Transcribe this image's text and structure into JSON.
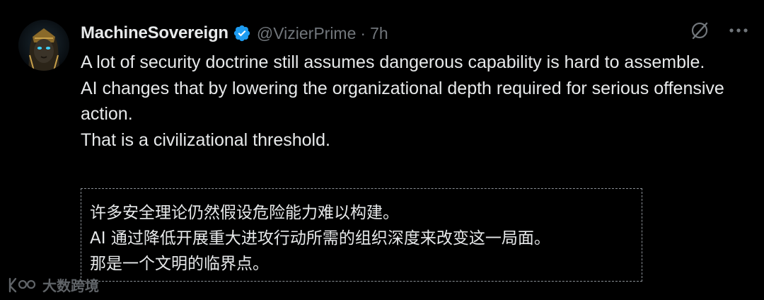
{
  "tweet": {
    "display_name": "MachineSovereign",
    "handle": "@VizierPrime",
    "separator": "·",
    "time": "7h",
    "body_lines": [
      "A lot of security doctrine still assumes dangerous capability is hard to assemble.",
      "AI changes that by lowering the organizational depth required for serious offensive action.",
      "That is a civilizational threshold."
    ],
    "translation_lines": [
      "许多安全理论仍然假设危险能力难以构建。",
      "AI 通过降低开展重大进攻行动所需的组织深度来改变这一局面。",
      "那是一个文明的临界点。"
    ]
  },
  "icons": {
    "verified": "verified-badge-icon",
    "grok": "grok-icon",
    "more": "more-icon",
    "avatar": "avatar"
  },
  "watermark": {
    "text": "大数跨境"
  },
  "colors": {
    "background": "#000000",
    "text": "#e7e9ea",
    "muted": "#71767b",
    "verified": "#1d9bf0",
    "dashed_border": "#8b9096"
  }
}
